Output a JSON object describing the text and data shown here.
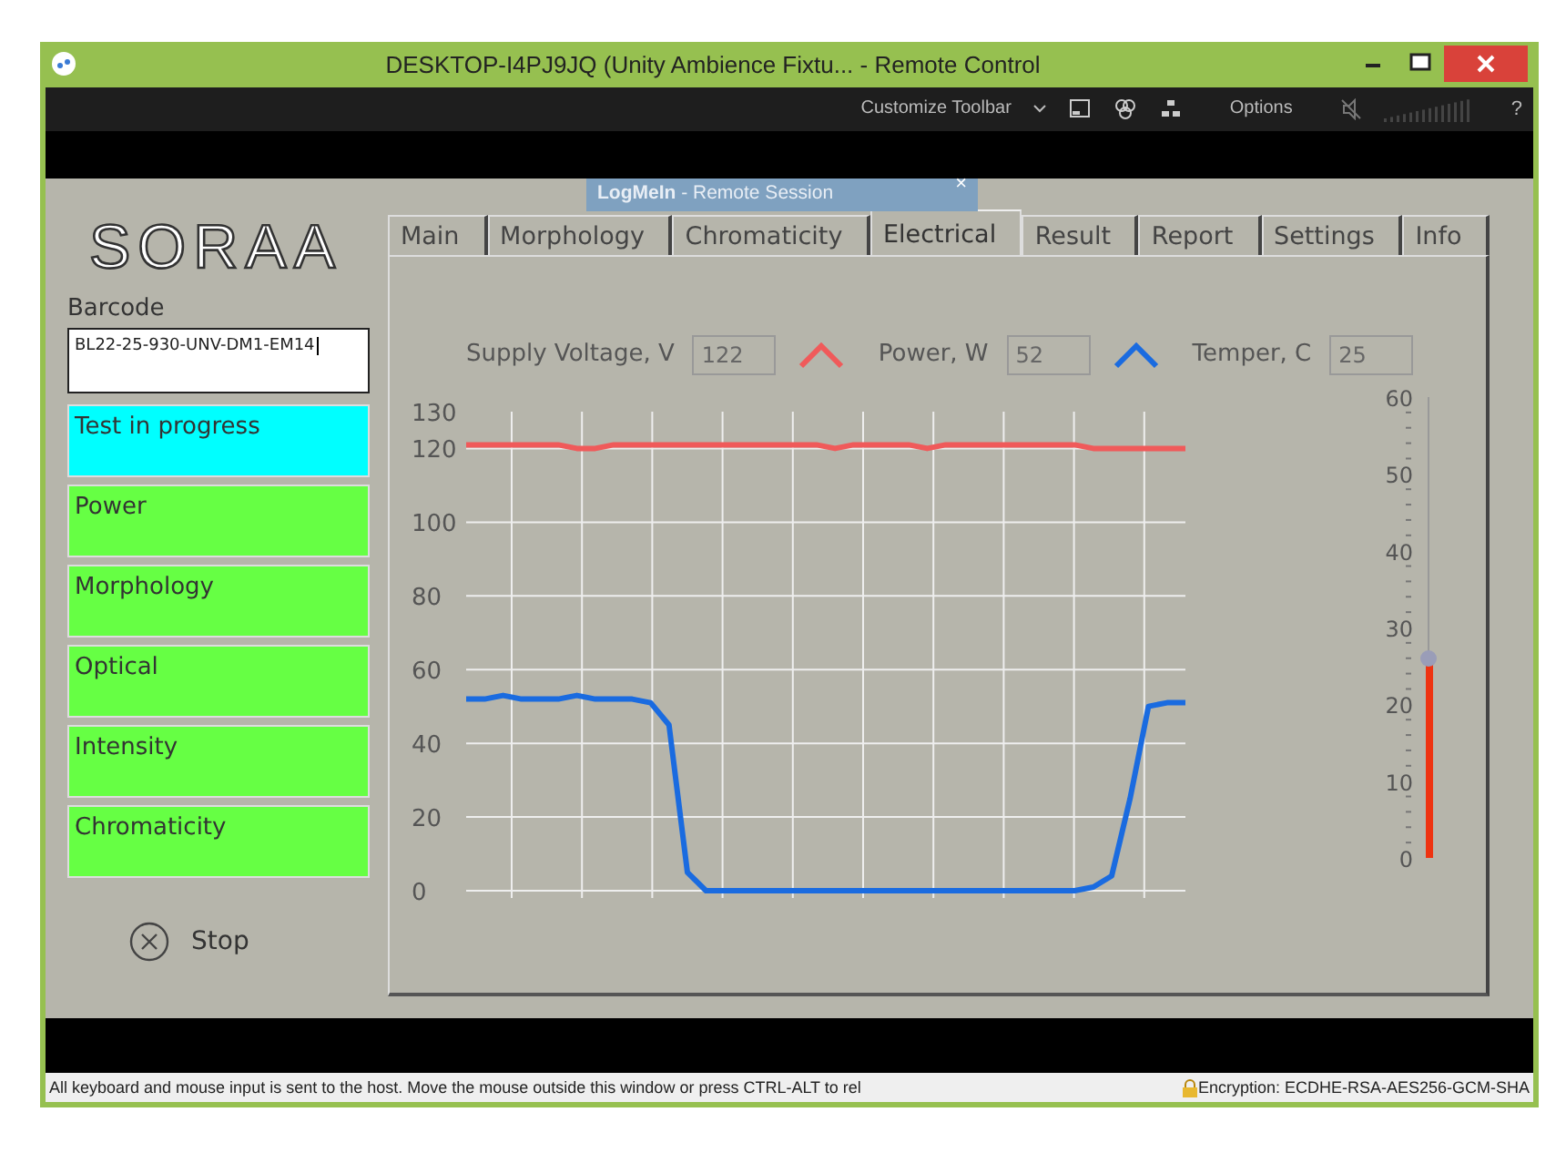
{
  "window": {
    "title": "DESKTOP-I4PJ9JQ (Unity Ambience Fixtu... - Remote Control"
  },
  "toolbar": {
    "customize": "Customize Toolbar",
    "options": "Options",
    "help": "?"
  },
  "session_tab": {
    "title": "**LogMeIn** - Remote Session",
    "close": "×"
  },
  "sidebar": {
    "logo": "SORAA",
    "barcode_label": "Barcode",
    "barcode_value": "BL22-25-930-UNV-DM1-EM14",
    "status_items": [
      {
        "label": "Test in progress",
        "color": "#00ffff"
      },
      {
        "label": "Power",
        "color": "#66ff44"
      },
      {
        "label": "Morphology",
        "color": "#66ff44"
      },
      {
        "label": "Optical",
        "color": "#66ff44"
      },
      {
        "label": "Intensity",
        "color": "#66ff44"
      },
      {
        "label": "Chromaticity",
        "color": "#66ff44"
      }
    ],
    "stop": "Stop"
  },
  "tabs": [
    {
      "label": "Main",
      "selected": false
    },
    {
      "label": "Morphology",
      "selected": false
    },
    {
      "label": "Chromaticity",
      "selected": false
    },
    {
      "label": "Electrical",
      "selected": true
    },
    {
      "label": "Result",
      "selected": false
    },
    {
      "label": "Report",
      "selected": false
    },
    {
      "label": "Settings",
      "selected": false
    },
    {
      "label": "Info",
      "selected": false
    }
  ],
  "readings": [
    {
      "label": "Supply Voltage, V",
      "value": "122",
      "color": "#f05a5a"
    },
    {
      "label": "Power, W",
      "value": "52",
      "color": "#1a6be0"
    },
    {
      "label": "Temper, C",
      "value": "25"
    }
  ],
  "chart_data": {
    "type": "line",
    "grid": true,
    "ylim": [
      0,
      130
    ],
    "yticks": [
      0,
      20,
      40,
      60,
      80,
      100,
      120,
      130
    ],
    "series": [
      {
        "color": "#f05a5a",
        "values": [
          121,
          121,
          121,
          121,
          121,
          121,
          120,
          120,
          121,
          121,
          121,
          121,
          121,
          121,
          121,
          121,
          121,
          121,
          121,
          121,
          120,
          121,
          121,
          121,
          121,
          120,
          121,
          121,
          121,
          121,
          121,
          121,
          121,
          121,
          120,
          120,
          120,
          120,
          120,
          120
        ]
      },
      {
        "color": "#1a6be0",
        "values": [
          52,
          52,
          53,
          52,
          52,
          52,
          53,
          52,
          52,
          52,
          51,
          45,
          5,
          0,
          0,
          0,
          0,
          0,
          0,
          0,
          0,
          0,
          0,
          0,
          0,
          0,
          0,
          0,
          0,
          0,
          0,
          0,
          0,
          0,
          1,
          4,
          25,
          50,
          51,
          51
        ]
      }
    ]
  },
  "temperature_gauge": {
    "ticks": [
      "60",
      "50",
      "40",
      "30",
      "20",
      "10",
      "0"
    ],
    "level": 0.43
  },
  "status_bar": {
    "message": "All keyboard and mouse input is sent to the host. Move the mouse outside this window or press CTRL-ALT to rel",
    "encryption": "Encryption: ECDHE-RSA-AES256-GCM-SHA"
  }
}
